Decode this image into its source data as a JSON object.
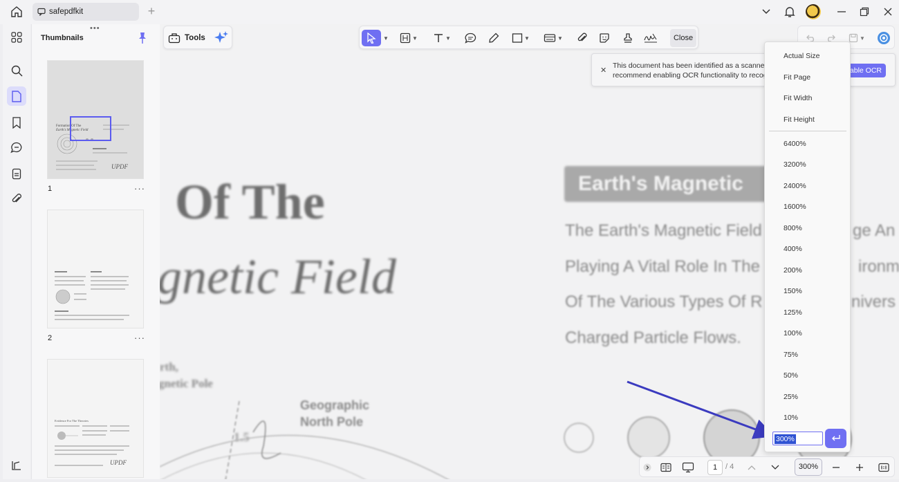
{
  "tab": {
    "title": "safepdfkit"
  },
  "sidebar": {
    "title": "Thumbnails",
    "handle": "•••"
  },
  "thumbnails": [
    {
      "page": "1",
      "more": "···",
      "title1": "Formation Of The",
      "title2": "Earth's Magnetic Field",
      "sig": "UPDF"
    },
    {
      "page": "2",
      "more": "···"
    },
    {
      "page": "3",
      "more": "···",
      "title1": "Evidence For The Theories",
      "sig": "UPDF"
    }
  ],
  "toolbar": {
    "tools_label": "Tools",
    "close_label": "Close"
  },
  "document": {
    "heading1": "Of The",
    "heading2": "gnetic Field",
    "badge": "Earth's Magnetic",
    "lines": [
      "The Earth's Magnetic Field",
      "Playing A Vital Role In The",
      "Of The Various Types Of R",
      "Charged Particle Flows."
    ],
    "right_lines": [
      "ge An",
      "ironme",
      "nivers"
    ],
    "label_north1": "rth,",
    "label_north2": "gnetic Pole",
    "geo1": "Geographic",
    "geo2": "North Pole",
    "angle": "1.5"
  },
  "ocr": {
    "message_line1": "This document has been identified as a scanned d",
    "message_line2": "recommend enabling OCR functionality to recogn",
    "button_label": "able OCR"
  },
  "zoom_menu": {
    "fit_options": [
      "Actual Size",
      "Fit Page",
      "Fit Width",
      "Fit Height"
    ],
    "percentages": [
      "6400%",
      "3200%",
      "2400%",
      "1600%",
      "800%",
      "400%",
      "200%",
      "150%",
      "125%",
      "100%",
      "75%",
      "50%",
      "25%",
      "10%"
    ],
    "input_value": "300%"
  },
  "bottom_bar": {
    "current_page": "1",
    "total_pages": "/ 4",
    "zoom": "300%"
  },
  "colors": {
    "accent": "#6f6ff2",
    "arrow": "#3b3bbf"
  }
}
